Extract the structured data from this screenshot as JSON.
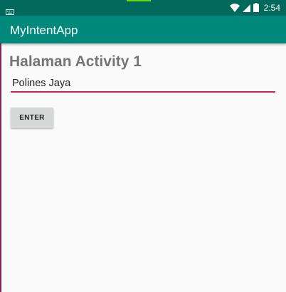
{
  "status_bar": {
    "time": "2:54",
    "icons": [
      "keyboard-icon",
      "wifi-icon",
      "signal-icon",
      "battery-icon"
    ],
    "color": "#00695c"
  },
  "app_bar": {
    "title": "MyIntentApp",
    "color": "#00897b"
  },
  "main": {
    "heading": "Halaman Activity 1",
    "input_value": "Polines Jaya",
    "enter_button_label": "ENTER",
    "accent_color": "#d81b60"
  }
}
